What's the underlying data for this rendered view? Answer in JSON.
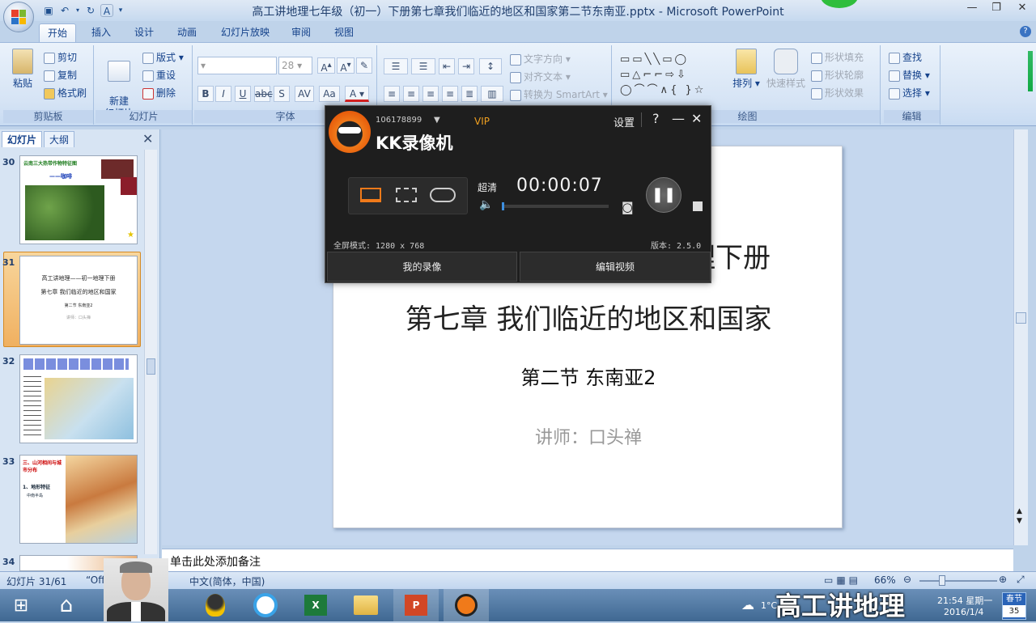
{
  "window": {
    "title": "高工讲地理七年级（初一）下册第七章我们临近的地区和国家第二节东南亚.pptx - Microsoft PowerPoint"
  },
  "ribbon_tabs": [
    "开始",
    "插入",
    "设计",
    "动画",
    "幻灯片放映",
    "审阅",
    "视图"
  ],
  "ribbon": {
    "clipboard": {
      "paste": "粘贴",
      "cut": "剪切",
      "copy": "复制",
      "format_painter": "格式刷",
      "label": "剪贴板"
    },
    "slides": {
      "new_slide": "新建\n幻灯片",
      "layout": "版式",
      "reset": "重设",
      "delete": "删除",
      "label": "幻灯片"
    },
    "font": {
      "size": "28",
      "label": "字体"
    },
    "paragraph": {
      "text_direction": "文字方向",
      "align_text": "对齐文本",
      "smartart": "转换为 SmartArt"
    },
    "drawing": {
      "arrange": "排列",
      "quick_styles": "快速样式",
      "shape_fill": "形状填充",
      "shape_outline": "形状轮廓",
      "shape_effects": "形状效果",
      "label": "绘图"
    },
    "editing": {
      "find": "查找",
      "replace": "替换",
      "select": "选择",
      "label": "编辑"
    }
  },
  "left_panel": {
    "tabs": [
      "幻灯片",
      "大纲"
    ],
    "slides": [
      {
        "num": "30",
        "title": "云南三大热带作物特征图",
        "subtitle": "——咖啡"
      },
      {
        "num": "31",
        "lines": [
          "高工讲地理——初一地理下册",
          "第七章 我们临近的地区和国家",
          "第二节 东南亚2",
          "讲师：口头禅"
        ]
      },
      {
        "num": "32"
      },
      {
        "num": "33",
        "title": "三、山河相间与城市分布",
        "lines": [
          "1、地形特征",
          "中南半岛"
        ]
      },
      {
        "num": "34"
      }
    ]
  },
  "slide": {
    "line1_partial": "理下册",
    "line2": "第七章 我们临近的地区和国家",
    "line3": "第二节 东南亚2",
    "line4": "讲师：口头禅"
  },
  "notes_placeholder": "单击此处添加备注",
  "status_bar": {
    "slide_count": "幻灯片 31/61",
    "theme": "“Off",
    "language": "中文(简体，中国)",
    "zoom": "66%"
  },
  "kk": {
    "user_id": "106178899",
    "vip": "VIP",
    "app_name": "KK录像机",
    "settings": "设置",
    "quality": "超清",
    "timer": "00:00:07",
    "mode": "全屏模式: 1280 x 768",
    "version": "版本: 2.5.0",
    "my_videos": "我的录像",
    "edit_video": "编辑视频"
  },
  "taskbar": {
    "time": "21:54 星期一",
    "date": "2016/1/4",
    "weather": "1°C",
    "holiday": "春节",
    "holiday_days": "35"
  },
  "overlay_text": "高工讲地理",
  "colors": {
    "ribbon_text": "#15428b",
    "kk_bg": "#1e1e1e",
    "kk_accent": "#f07a1a",
    "slide_sub": "#999999"
  }
}
